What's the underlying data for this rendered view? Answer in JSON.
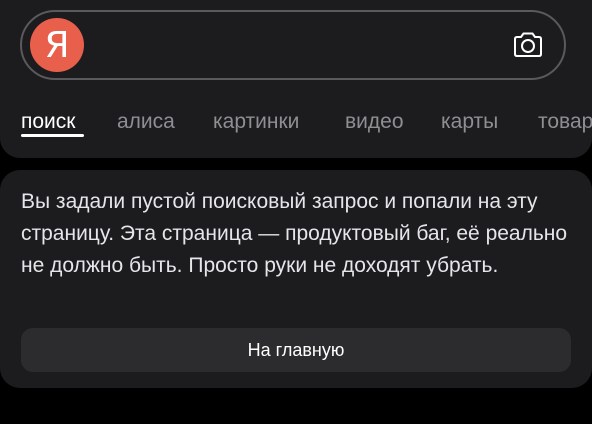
{
  "search": {
    "logo_letter": "Я",
    "value": "",
    "placeholder": "",
    "camera_icon": "camera-icon"
  },
  "tabs": [
    {
      "label": "поиск",
      "active": true
    },
    {
      "label": "алиса",
      "active": false
    },
    {
      "label": "картинки",
      "active": false
    },
    {
      "label": "видео",
      "active": false
    },
    {
      "label": "карты",
      "active": false
    },
    {
      "label": "товары",
      "active": false
    }
  ],
  "message": {
    "text": "Вы задали пустой поисковый запрос и попали на эту страницу. Эта страница — продуктовый баг, её реально не должно быть. Просто руки не доходят убрать.",
    "button_label": "На главную"
  },
  "colors": {
    "background": "#000000",
    "panel": "#1c1c1e",
    "logo": "#e8604c",
    "inactive_tab": "#8e8e93",
    "button": "#2c2c2e"
  }
}
